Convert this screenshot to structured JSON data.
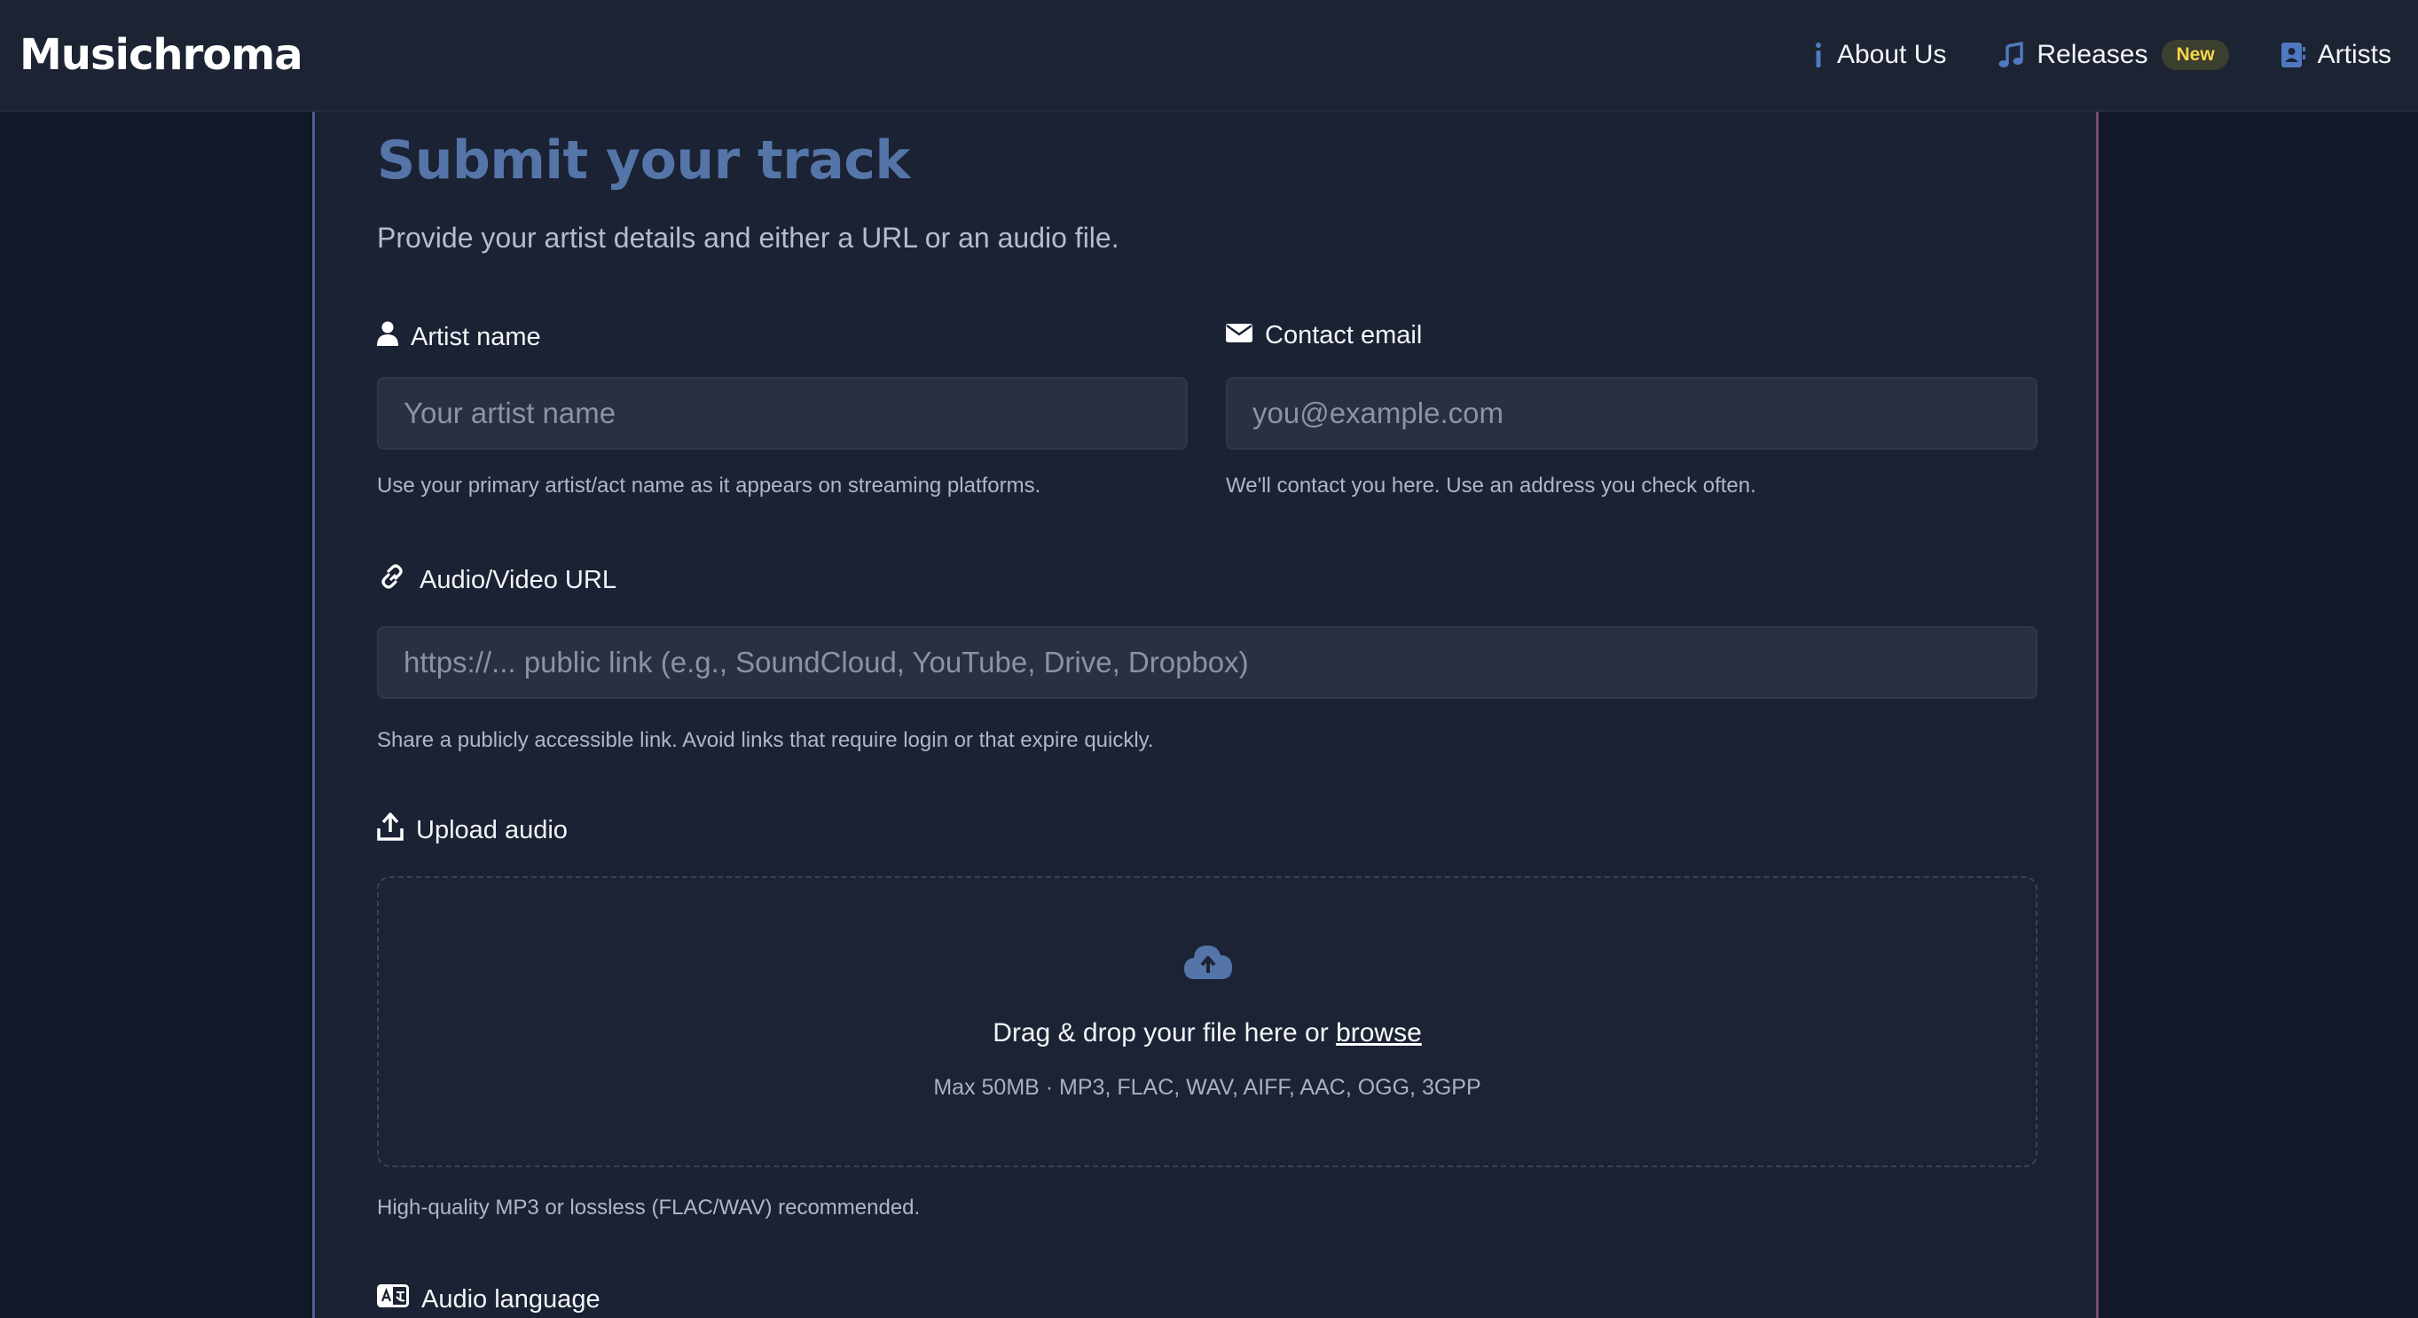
{
  "header": {
    "logo": "Musichroma",
    "nav": [
      {
        "label": "About Us",
        "icon": "info-icon"
      },
      {
        "label": "Releases",
        "icon": "music-note-icon",
        "badge": "New"
      },
      {
        "label": "Artists",
        "icon": "contact-book-icon"
      }
    ]
  },
  "form": {
    "title": "Submit your track",
    "subtitle": "Provide your artist details and either a URL or an audio file.",
    "artist": {
      "label": "Artist name",
      "placeholder": "Your artist name",
      "value": "",
      "help": "Use your primary artist/act name as it appears on streaming platforms."
    },
    "email": {
      "label": "Contact email",
      "placeholder": "you@example.com",
      "value": "",
      "help": "We'll contact you here. Use an address you check often."
    },
    "url": {
      "label": "Audio/Video URL",
      "placeholder": "https://... public link (e.g., SoundCloud, YouTube, Drive, Dropbox)",
      "value": "",
      "help": "Share a publicly accessible link. Avoid links that require login or that expire quickly."
    },
    "upload": {
      "label": "Upload audio",
      "drop_text": "Drag & drop your file here or ",
      "browse": "browse",
      "formats": "Max 50MB · MP3, FLAC, WAV, AIFF, AAC, OGG, 3GPP",
      "help": "High-quality MP3 or lossless (FLAC/WAV) recommended."
    },
    "language": {
      "label": "Audio language"
    }
  },
  "colors": {
    "background": "#111827",
    "topbar": "#1c2333",
    "title": "#5575a8",
    "accent_icon": "#4f79c2",
    "badge_text": "#f6d54a"
  }
}
